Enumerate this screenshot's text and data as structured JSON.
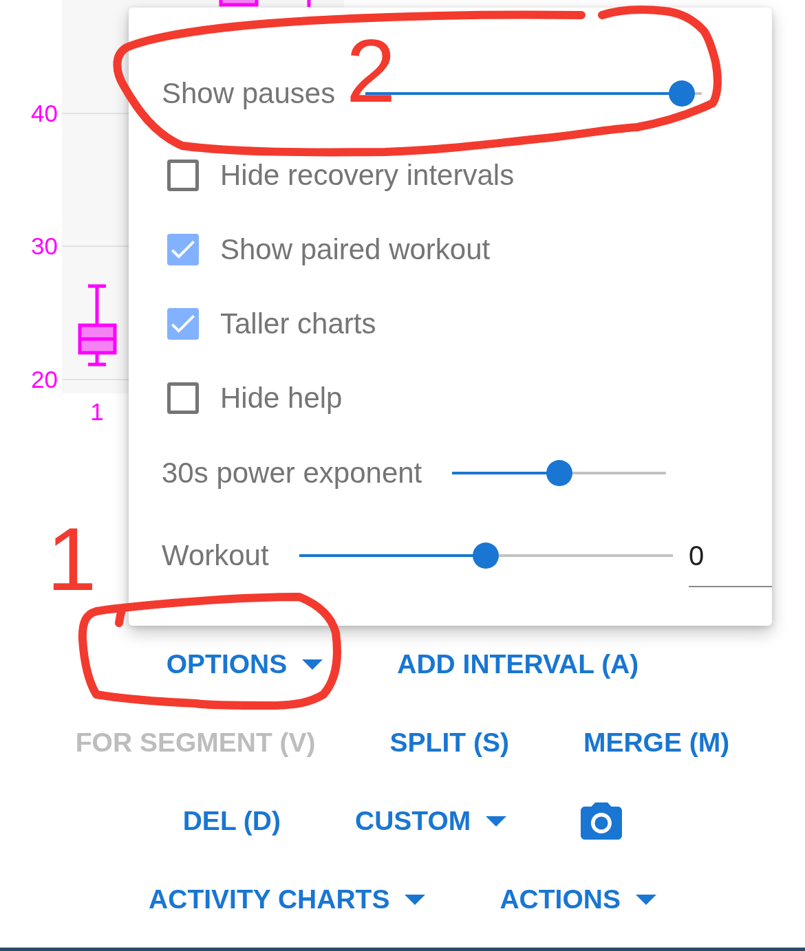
{
  "chart": {
    "y_tick_labels": [
      "40",
      "30",
      "20"
    ],
    "x_tick_labels": [
      "1"
    ]
  },
  "options_menu": {
    "items": [
      {
        "kind": "slider",
        "label": "Show pauses",
        "level": 0.94
      },
      {
        "kind": "checkbox",
        "label": "Hide recovery intervals",
        "checked": false
      },
      {
        "kind": "checkbox",
        "label": "Show paired workout",
        "checked": true
      },
      {
        "kind": "checkbox",
        "label": "Taller charts",
        "checked": true
      },
      {
        "kind": "checkbox",
        "label": "Hide help",
        "checked": false
      },
      {
        "kind": "slider",
        "label": "30s power exponent",
        "level": 0.5
      },
      {
        "kind": "slider",
        "label": "Workout",
        "level": 0.5,
        "value": "0"
      }
    ]
  },
  "toolbar_rows": [
    [
      {
        "kind": "dropdown",
        "label": "OPTIONS",
        "disabled": false
      },
      {
        "kind": "text",
        "label": "ADD INTERVAL (A)",
        "disabled": false
      }
    ],
    [
      {
        "kind": "text",
        "label": "FOR SEGMENT (V)",
        "disabled": true
      },
      {
        "kind": "text",
        "label": "SPLIT (S)",
        "disabled": false
      },
      {
        "kind": "text",
        "label": "MERGE (M)",
        "disabled": false
      }
    ],
    [
      {
        "kind": "text",
        "label": "DEL (D)",
        "disabled": false
      },
      {
        "kind": "dropdown",
        "label": "CUSTOM",
        "disabled": false
      },
      {
        "kind": "icon",
        "disabled": false
      }
    ],
    [
      {
        "kind": "dropdown",
        "label": "ACTIVITY CHARTS",
        "disabled": false
      },
      {
        "kind": "dropdown",
        "label": "ACTIONS",
        "disabled": false
      }
    ]
  ],
  "annotations": [
    {
      "label": "2"
    },
    {
      "label": "1"
    }
  ]
}
